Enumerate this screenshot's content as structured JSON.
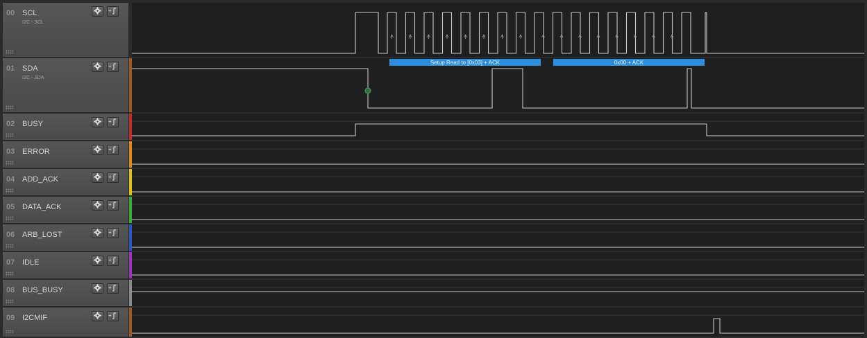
{
  "channels": [
    {
      "num": "00",
      "name": "SCL",
      "sub": "I2C - SCL",
      "color": "",
      "signal": "scl"
    },
    {
      "num": "01",
      "name": "SDA",
      "sub": "I2C - SDA",
      "color": "#9a5a28",
      "signal": "sda"
    },
    {
      "num": "02",
      "name": "BUSY",
      "sub": "",
      "color": "#c62a2a",
      "signal": "busy"
    },
    {
      "num": "03",
      "name": "ERROR",
      "sub": "",
      "color": "#e08a12",
      "signal": "flat"
    },
    {
      "num": "04",
      "name": "ADD_ACK",
      "sub": "",
      "color": "#d9c115",
      "signal": "flat"
    },
    {
      "num": "05",
      "name": "DATA_ACK",
      "sub": "",
      "color": "#3fa83a",
      "signal": "flat"
    },
    {
      "num": "06",
      "name": "ARB_LOST",
      "sub": "",
      "color": "#2e56c0",
      "signal": "flat"
    },
    {
      "num": "07",
      "name": "IDLE",
      "sub": "",
      "color": "#9a32c2",
      "signal": "flat"
    },
    {
      "num": "08",
      "name": "BUS_BUSY",
      "sub": "",
      "color": "#8a8a8a",
      "signal": "flat_mid"
    },
    {
      "num": "09",
      "name": "I2CMIF",
      "sub": "",
      "color": "#9a5a28",
      "signal": "pulse"
    }
  ],
  "decodes": [
    {
      "label": "Setup Read to [0x03] + ACK"
    },
    {
      "label": "0x00 + ACK"
    }
  ],
  "colors": {
    "wave": "#c8c8c8",
    "wave_bg": "#1f1f1f",
    "decode_bg": "#2b8de0",
    "decode_text": "#e6f2ff",
    "marker": "#2e6e3a"
  },
  "icons": {
    "settings": "gear-icon",
    "trigger": "trigger-edge-icon"
  }
}
